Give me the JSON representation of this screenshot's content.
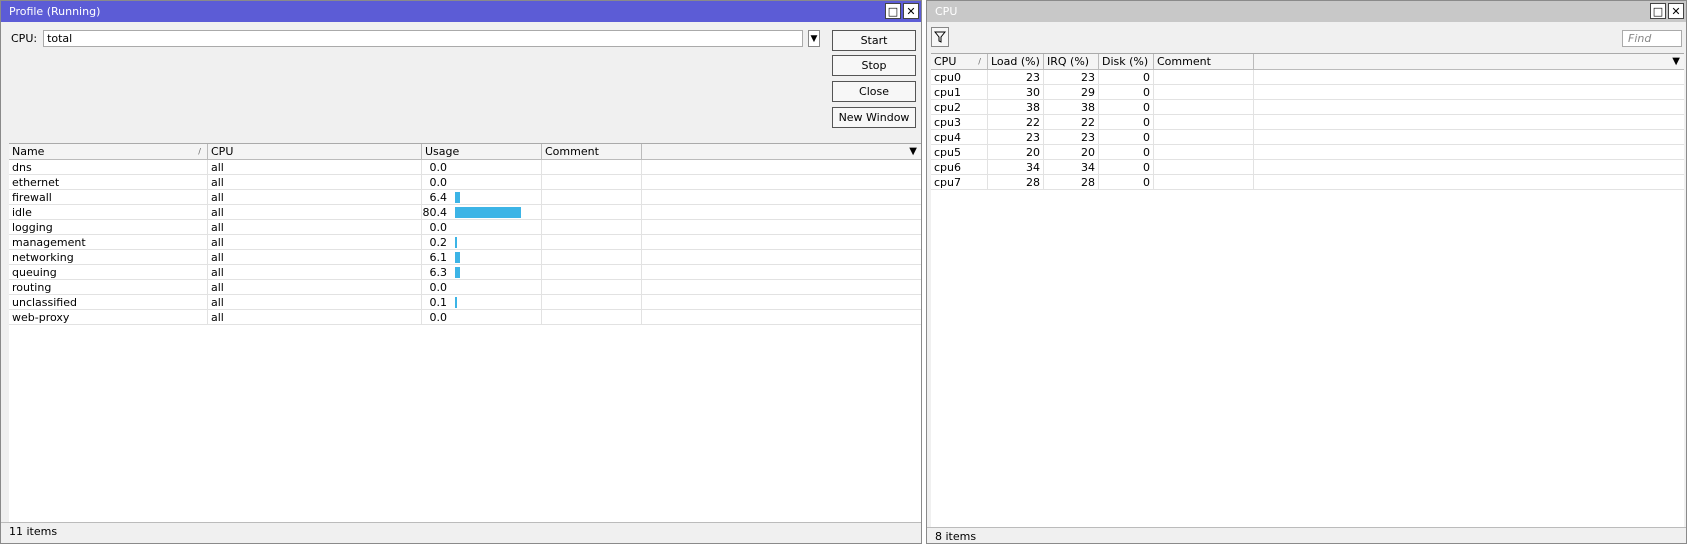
{
  "profile_window": {
    "title": "Profile (Running)",
    "cpu_label": "CPU:",
    "cpu_value": "total",
    "buttons": {
      "start": "Start",
      "stop": "Stop",
      "close": "Close",
      "new_window": "New Window"
    },
    "columns": [
      "Name",
      "CPU",
      "Usage",
      "Comment"
    ],
    "rows": [
      {
        "name": "dns",
        "cpu": "all",
        "usage": "0.0",
        "usage_pct": 0.0
      },
      {
        "name": "ethernet",
        "cpu": "all",
        "usage": "0.0",
        "usage_pct": 0.0
      },
      {
        "name": "firewall",
        "cpu": "all",
        "usage": "6.4",
        "usage_pct": 6.4
      },
      {
        "name": "idle",
        "cpu": "all",
        "usage": "80.4",
        "usage_pct": 80.4
      },
      {
        "name": "logging",
        "cpu": "all",
        "usage": "0.0",
        "usage_pct": 0.0
      },
      {
        "name": "management",
        "cpu": "all",
        "usage": "0.2",
        "usage_pct": 0.2
      },
      {
        "name": "networking",
        "cpu": "all",
        "usage": "6.1",
        "usage_pct": 6.1
      },
      {
        "name": "queuing",
        "cpu": "all",
        "usage": "6.3",
        "usage_pct": 6.3
      },
      {
        "name": "routing",
        "cpu": "all",
        "usage": "0.0",
        "usage_pct": 0.0
      },
      {
        "name": "unclassified",
        "cpu": "all",
        "usage": "0.1",
        "usage_pct": 0.1
      },
      {
        "name": "web-proxy",
        "cpu": "all",
        "usage": "0.0",
        "usage_pct": 0.0
      }
    ],
    "status": "11 items"
  },
  "cpu_window": {
    "title": "CPU",
    "find_placeholder": "Find",
    "columns": [
      "CPU",
      "Load (%)",
      "IRQ (%)",
      "Disk (%)",
      "Comment"
    ],
    "rows": [
      {
        "cpu": "cpu0",
        "load": "23",
        "irq": "23",
        "disk": "0"
      },
      {
        "cpu": "cpu1",
        "load": "30",
        "irq": "29",
        "disk": "0"
      },
      {
        "cpu": "cpu2",
        "load": "38",
        "irq": "38",
        "disk": "0"
      },
      {
        "cpu": "cpu3",
        "load": "22",
        "irq": "22",
        "disk": "0"
      },
      {
        "cpu": "cpu4",
        "load": "23",
        "irq": "23",
        "disk": "0"
      },
      {
        "cpu": "cpu5",
        "load": "20",
        "irq": "20",
        "disk": "0"
      },
      {
        "cpu": "cpu6",
        "load": "34",
        "irq": "34",
        "disk": "0"
      },
      {
        "cpu": "cpu7",
        "load": "28",
        "irq": "28",
        "disk": "0"
      }
    ],
    "status": "8 items"
  },
  "colors": {
    "title_active": "#5c5cd6",
    "usage_bar": "#3cb4e6"
  },
  "icons": {
    "maximize": "maximize-icon",
    "close": "close-icon",
    "filter": "filter-icon",
    "dropdown": "dropdown-arrow-icon"
  }
}
